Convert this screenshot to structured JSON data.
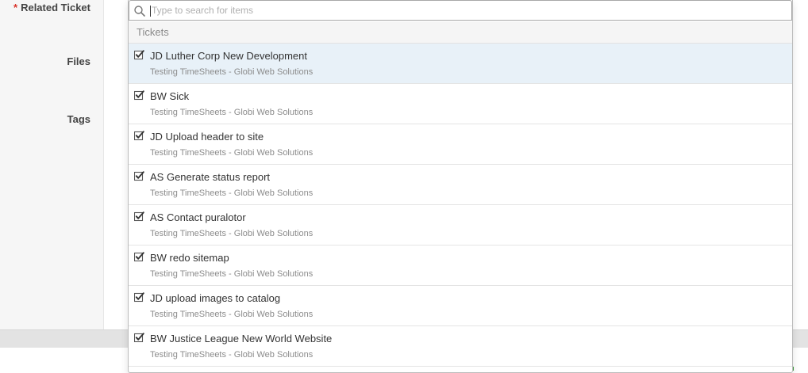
{
  "form": {
    "required_marker": "*",
    "related_ticket_label": "Related Ticket",
    "files_label": "Files",
    "tags_label": "Tags"
  },
  "search": {
    "placeholder": "Type to search for items",
    "value": "",
    "icon": "search-icon"
  },
  "dropdown": {
    "group_label": "Tickets",
    "items": [
      {
        "title": "JD Luther Corp New Development",
        "subtitle": "Testing TimeSheets - Globi Web Solutions",
        "checked": true,
        "highlighted": true
      },
      {
        "title": "BW Sick",
        "subtitle": "Testing TimeSheets - Globi Web Solutions",
        "checked": true,
        "highlighted": false
      },
      {
        "title": "JD Upload header to site",
        "subtitle": "Testing TimeSheets - Globi Web Solutions",
        "checked": true,
        "highlighted": false
      },
      {
        "title": "AS Generate status report",
        "subtitle": "Testing TimeSheets - Globi Web Solutions",
        "checked": true,
        "highlighted": false
      },
      {
        "title": "AS Contact puralotor",
        "subtitle": "Testing TimeSheets - Globi Web Solutions",
        "checked": true,
        "highlighted": false
      },
      {
        "title": "BW redo sitemap",
        "subtitle": "Testing TimeSheets - Globi Web Solutions",
        "checked": true,
        "highlighted": false
      },
      {
        "title": "JD upload images to catalog",
        "subtitle": "Testing TimeSheets - Globi Web Solutions",
        "checked": true,
        "highlighted": false
      },
      {
        "title": "BW Justice League New World Website",
        "subtitle": "Testing TimeSheets - Globi Web Solutions",
        "checked": true,
        "highlighted": false
      }
    ]
  },
  "colors": {
    "required": "#d9342b",
    "highlight_row": "#e8f1f8",
    "footer_accent": "#3c9a3c"
  }
}
